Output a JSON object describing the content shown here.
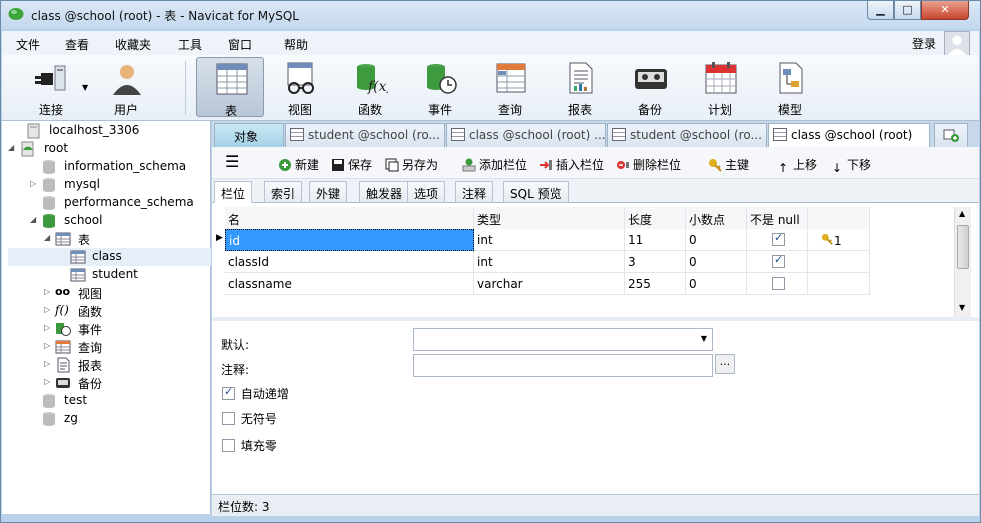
{
  "window": {
    "title": "class @school (root) - 表 - Navicat for MySQL",
    "minimize_glyph": "▁",
    "maximize_glyph": "□",
    "close_glyph": "✕"
  },
  "menu": {
    "items": [
      "文件",
      "查看",
      "收藏夹",
      "工具",
      "窗口",
      "帮助"
    ],
    "login": "登录"
  },
  "toolbar": {
    "items": [
      {
        "label": "连接",
        "icon": "plug-icon"
      },
      {
        "label": "用户",
        "icon": "user-icon"
      },
      {
        "label": "表",
        "icon": "table-icon",
        "active": true
      },
      {
        "label": "视图",
        "icon": "view-icon"
      },
      {
        "label": "函数",
        "icon": "function-icon"
      },
      {
        "label": "事件",
        "icon": "event-icon"
      },
      {
        "label": "查询",
        "icon": "query-icon"
      },
      {
        "label": "报表",
        "icon": "report-icon"
      },
      {
        "label": "备份",
        "icon": "backup-icon"
      },
      {
        "label": "计划",
        "icon": "schedule-icon"
      },
      {
        "label": "模型",
        "icon": "model-icon"
      }
    ]
  },
  "sidebar": {
    "connection": "localhost_3306",
    "root": "root",
    "databases": [
      "information_schema",
      "mysql",
      "performance_schema",
      "school",
      "test",
      "zg"
    ],
    "school_nodes": {
      "tables": "表",
      "views": "视图",
      "functions": "函数",
      "events": "事件",
      "queries": "查询",
      "reports": "报表",
      "backups": "备份"
    },
    "tables": [
      "class",
      "student"
    ]
  },
  "doc_tabs": {
    "object": "对象",
    "tabs": [
      "student @school (ro...",
      "class @school (root) ...",
      "student @school (ro...",
      "class @school (root)"
    ]
  },
  "content_toolbar": {
    "new": "新建",
    "save": "保存",
    "save_as": "另存为",
    "add_field": "添加栏位",
    "insert_field": "插入栏位",
    "delete_field": "删除栏位",
    "primary_key": "主键",
    "move_up": "上移",
    "move_down": "下移"
  },
  "sub_tabs": [
    "栏位",
    "索引",
    "外键",
    "触发器",
    "选项",
    "注释",
    "SQL 预览"
  ],
  "grid": {
    "headers": [
      "名",
      "类型",
      "长度",
      "小数点",
      "不是 null",
      ""
    ],
    "rows": [
      {
        "name": "id",
        "type": "int",
        "length": "11",
        "decimals": "0",
        "not_null": true,
        "key": "1"
      },
      {
        "name": "classId",
        "type": "int",
        "length": "3",
        "decimals": "0",
        "not_null": true,
        "key": ""
      },
      {
        "name": "classname",
        "type": "varchar",
        "length": "255",
        "decimals": "0",
        "not_null": false,
        "key": ""
      }
    ]
  },
  "properties": {
    "default_label": "默认:",
    "comment_label": "注释:",
    "auto_increment": "自动递增",
    "auto_increment_checked": true,
    "unsigned": "无符号",
    "unsigned_checked": false,
    "zerofill": "填充零",
    "zerofill_checked": false,
    "browse_button": "..."
  },
  "status": {
    "field_count": "栏位数: 3"
  },
  "colors": {
    "selection": "#3399ff",
    "titlebar": "#c4d8ee",
    "close": "#c8452e"
  }
}
